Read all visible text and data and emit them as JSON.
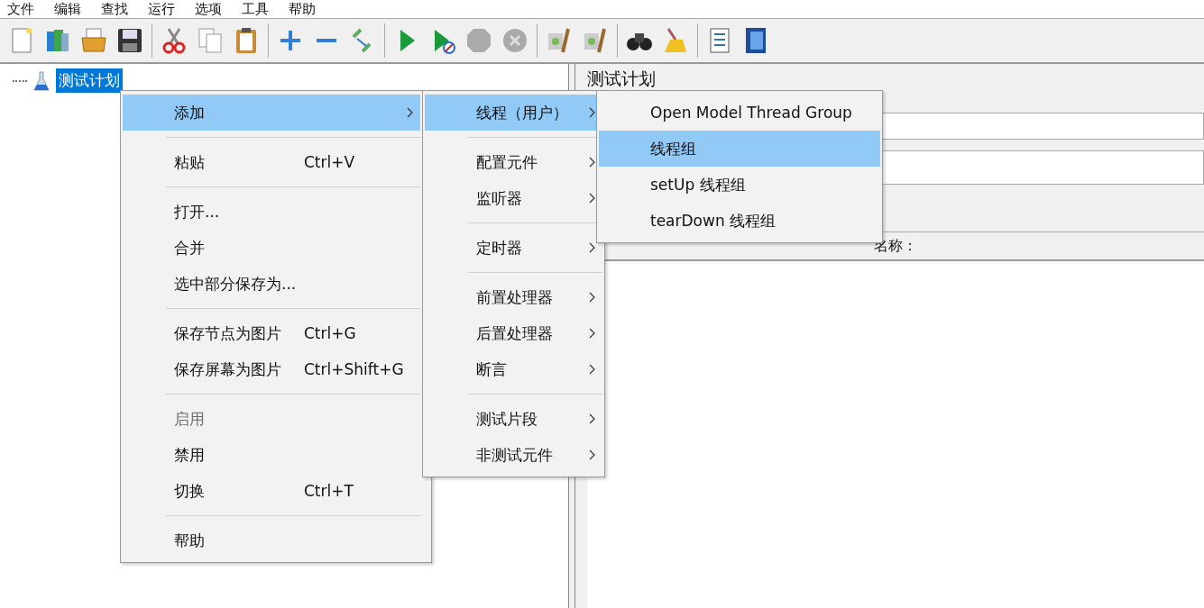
{
  "menu_bar": [
    "文件",
    "编辑",
    "查找",
    "运行",
    "选项",
    "工具",
    "帮助"
  ],
  "tree": [
    {
      "label": "测试计划",
      "selected": true
    }
  ],
  "panel": {
    "title": "测试计划",
    "table_header": "名称："
  },
  "context_menu": [
    {
      "kind": "item",
      "label": "添加",
      "submenu": true,
      "selected": true,
      "disabled": false
    },
    {
      "kind": "separator"
    },
    {
      "kind": "item",
      "label": "粘贴",
      "shortcut": "Ctrl+V",
      "submenu": false,
      "selected": false,
      "disabled": false
    },
    {
      "kind": "separator"
    },
    {
      "kind": "item",
      "label": "打开...",
      "submenu": false,
      "selected": false,
      "disabled": false
    },
    {
      "kind": "item",
      "label": "合并",
      "submenu": false,
      "selected": false,
      "disabled": false
    },
    {
      "kind": "item",
      "label": "选中部分保存为...",
      "submenu": false,
      "selected": false,
      "disabled": false
    },
    {
      "kind": "separator"
    },
    {
      "kind": "item",
      "label": "保存节点为图片",
      "shortcut": "Ctrl+G",
      "submenu": false,
      "selected": false,
      "disabled": false
    },
    {
      "kind": "item",
      "label": "保存屏幕为图片",
      "shortcut": "Ctrl+Shift+G",
      "submenu": false,
      "selected": false,
      "disabled": false
    },
    {
      "kind": "separator"
    },
    {
      "kind": "item",
      "label": "启用",
      "submenu": false,
      "selected": false,
      "disabled": true
    },
    {
      "kind": "item",
      "label": "禁用",
      "submenu": false,
      "selected": false,
      "disabled": false
    },
    {
      "kind": "item",
      "label": "切换",
      "shortcut": "Ctrl+T",
      "submenu": false,
      "selected": false,
      "disabled": false
    },
    {
      "kind": "separator"
    },
    {
      "kind": "item",
      "label": "帮助",
      "submenu": false,
      "selected": false,
      "disabled": false
    }
  ],
  "add_submenu": [
    {
      "kind": "item",
      "label": "线程（用户）",
      "submenu": true,
      "selected": true
    },
    {
      "kind": "separator"
    },
    {
      "kind": "item",
      "label": "配置元件",
      "submenu": true,
      "selected": false
    },
    {
      "kind": "item",
      "label": "监听器",
      "submenu": true,
      "selected": false
    },
    {
      "kind": "separator"
    },
    {
      "kind": "item",
      "label": "定时器",
      "submenu": true,
      "selected": false
    },
    {
      "kind": "separator"
    },
    {
      "kind": "item",
      "label": "前置处理器",
      "submenu": true,
      "selected": false
    },
    {
      "kind": "item",
      "label": "后置处理器",
      "submenu": true,
      "selected": false
    },
    {
      "kind": "item",
      "label": "断言",
      "submenu": true,
      "selected": false
    },
    {
      "kind": "separator"
    },
    {
      "kind": "item",
      "label": "测试片段",
      "submenu": true,
      "selected": false
    },
    {
      "kind": "item",
      "label": "非测试元件",
      "submenu": true,
      "selected": false
    }
  ],
  "threads_submenu": [
    {
      "label": "Open Model Thread Group",
      "selected": false
    },
    {
      "label": "线程组",
      "selected": true
    },
    {
      "label": "setUp 线程组",
      "selected": false
    },
    {
      "label": "tearDown 线程组",
      "selected": false
    }
  ]
}
